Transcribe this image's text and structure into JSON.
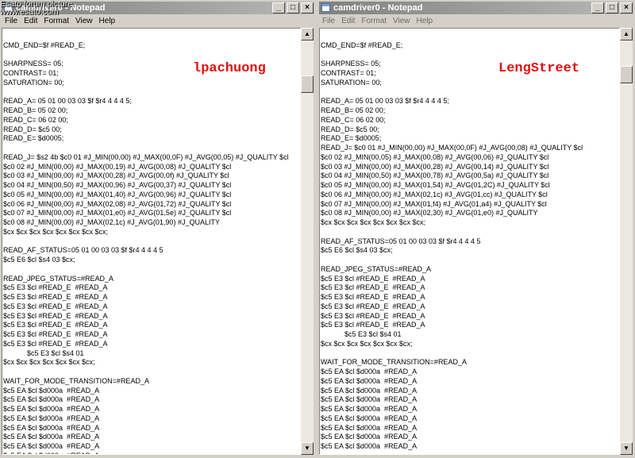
{
  "watermark": {
    "line1": "Esato forum picture",
    "line2": "www.esato.com"
  },
  "left_window": {
    "title": "camdriver0 - Notepad",
    "menu": [
      "File",
      "Edit",
      "Format",
      "View",
      "Help"
    ],
    "annotation": "lpachuong",
    "lines": [
      "",
      "CMD_END=$f #READ_E;",
      "",
      "SHARPNESS= 05;",
      "CONTRAST= 01;",
      "SATURATION= 00;",
      "",
      "READ_A= 05 01 00 03 03 $f $r4 4 4 4 5;",
      "READ_B= 05 02 00;",
      "READ_C= 06 02 00;",
      "READ_D= $c5 00;",
      "READ_E= $d0005;",
      "",
      "READ_J= $s2 4b $c0 01 #J_MIN(00,00) #J_MAX(00,0F) #J_AVG(00,05) #J_QUALITY $cl",
      "$c0 02 #J_MIN(00,00) #J_MAX(00,19) #J_AVG(00,08) #J_QUALITY $cl",
      "$c0 03 #J_MIN(00,00) #J_MAX(00,28) #J_AVG(00,0f) #J_QUALITY $cl",
      "$c0 04 #J_MIN(00,50) #J_MAX(00,96) #J_AVG(00,37) #J_QUALITY $cl",
      "$c0 05 #J_MIN(00,00) #J_MAX(01,40) #J_AVG(00,96) #J_QUALITY $cl",
      "$c0 06 #J_MIN(00,00) #J_MAX(02,08) #J_AVG(01,72) #J_QUALITY $cl",
      "$c0 07 #J_MIN(00,00) #J_MAX(01,e0) #J_AVG(01,5e) #J_QUALITY $cl",
      "$c0 08 #J_MIN(00,00) #J_MAX(02,1c) #J_AVG(01,90) #J_QUALITY",
      "$cx $cx $cx $cx $cx $cx $cx $cx;",
      "",
      "READ_AF_STATUS=05 01 00 03 03 $f $r4 4 4 4 5",
      "$c5 E6 $cl $s4 03 $cx;",
      "",
      "READ_JPEG_STATUS=#READ_A",
      "$c5 E3 $cl #READ_E  #READ_A",
      "$c5 E3 $cl #READ_E  #READ_A",
      "$c5 E3 $cl #READ_E  #READ_A",
      "$c5 E3 $cl #READ_E  #READ_A",
      "$c5 E3 $cl #READ_E  #READ_A",
      "$c5 E3 $cl #READ_E  #READ_A",
      "$c5 E3 $cl #READ_E  #READ_A",
      "            $c5 E3 $cl $s4 01",
      "$cx $cx $cx $cx $cx $cx $cx;",
      "",
      "WAIT_FOR_MODE_TRANSITION=#READ_A",
      "$c5 EA $cl $d000a  #READ_A",
      "$c5 EA $cl $d000a  #READ_A",
      "$c5 EA $cl $d000a  #READ_A",
      "$c5 EA $cl $d000a  #READ_A",
      "$c5 EA $cl $d000a  #READ_A",
      "$c5 EA $cl $d000a  #READ_A",
      "$c5 EA $cl $d000a  #READ_A",
      "$c5 EA $cl $d000a  #READ_A"
    ]
  },
  "right_window": {
    "title": "camdriver0 - Notepad",
    "menu": [
      "File",
      "Edit",
      "Format",
      "View",
      "Help"
    ],
    "annotation": "LengStreet",
    "lines": [
      "",
      "CMD_END=$f #READ_E;",
      "",
      "SHARPNESS= 05;",
      "CONTRAST= 01;",
      "SATURATION= 00;",
      "",
      "READ_A= 05 01 00 03 03 $f $r4 4 4 4 5;",
      "READ_B= 05 02 00;",
      "READ_C= 06 02 00;",
      "READ_D= $c5 00;",
      "READ_E= $d0005;",
      "READ_J= $c0 01 #J_MIN(00,00) #J_MAX(00,0F) #J_AVG(00,08) #J_QUALITY $cl",
      "$c0 02 #J_MIN(00,05) #J_MAX(00,08) #J_AVG(00,06) #J_QUALITY $cl",
      "$c0 03 #J_MIN(00,00) #J_MAX(00,28) #J_AVG(00,14) #J_QUALITY $cl",
      "$c0 04 #J_MIN(00,50) #J_MAX(00,78) #J_AVG(00,5a) #J_QUALITY $cl",
      "$c0 05 #J_MIN(00,00) #J_MAX(01,54) #J_AVG(01,2C) #J_QUALITY $cl",
      "$c0 06 #J_MIN(00,00) #J_MAX(02,1c) #J_AVG(01,cc) #J_QUALITY $cl",
      "$c0 07 #J_MIN(00,00) #J_MAX(01,f4) #J_AVG(01,a4) #J_QUALITY $cl",
      "$c0 08 #J_MIN(00,00) #J_MAX(02,30) #J_AVG(01,e0) #J_QUALITY",
      "$cx $cx $cx $cx $cx $cx $cx $cx;",
      "",
      "READ_AF_STATUS=05 01 00 03 03 $f $r4 4 4 4 5",
      "$c5 E6 $cl $s4 03 $cx;",
      "",
      "READ_JPEG_STATUS=#READ_A",
      "$c5 E3 $cl #READ_E  #READ_A",
      "$c5 E3 $cl #READ_E  #READ_A",
      "$c5 E3 $cl #READ_E  #READ_A",
      "$c5 E3 $cl #READ_E  #READ_A",
      "$c5 E3 $cl #READ_E  #READ_A",
      "$c5 E3 $cl #READ_E  #READ_A",
      "            $c5 E3 $cl $s4 01",
      "$cx $cx $cx $cx $cx $cx $cx;",
      "",
      "WAIT_FOR_MODE_TRANSITION=#READ_A",
      "$c5 EA $cl $d000a  #READ_A",
      "$c5 EA $cl $d000a  #READ_A",
      "$c5 EA $cl $d000a  #READ_A",
      "$c5 EA $cl $d000a  #READ_A",
      "$c5 EA $cl $d000a  #READ_A",
      "$c5 EA $cl $d000a  #READ_A",
      "$c5 EA $cl $d000a  #READ_A",
      "$c5 EA $cl $d000a  #READ_A",
      "$c5 EA $cl $d000a  #READ_A"
    ]
  },
  "icons": {
    "minimize": "minimize-icon",
    "maximize": "maximize-icon",
    "close": "close-icon",
    "scroll_up": "arrow-up-icon",
    "scroll_down": "arrow-down-icon"
  },
  "colors": {
    "annotation": "#e01010",
    "titlebar_inactive": "#808080"
  }
}
